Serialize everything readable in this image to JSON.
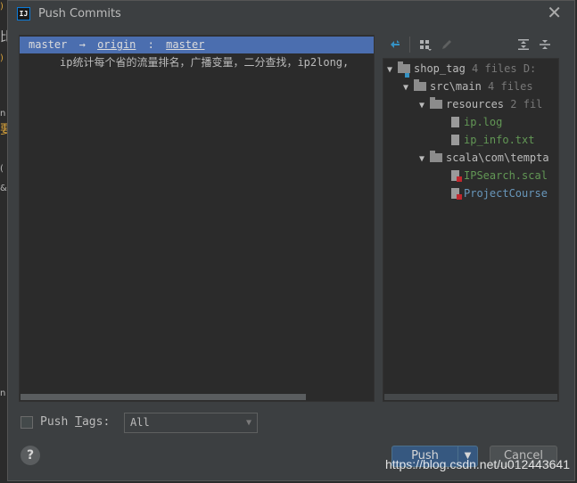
{
  "window": {
    "title": "Push Commits",
    "icon_label": "IJ"
  },
  "commits": {
    "header": {
      "local_branch": "master",
      "arrow": "→",
      "remote": "origin",
      "separator": ":",
      "remote_branch": "master"
    },
    "rows": [
      {
        "message": "ip统计每个省的流量排名，广播变量，二分查找，ip2long,"
      }
    ]
  },
  "toolbar": {
    "icons": [
      "expand-changes-icon",
      "group-by-icon",
      "edit-icon",
      "expand-all-icon",
      "collapse-all-icon"
    ]
  },
  "tree": {
    "nodes": [
      {
        "label": "shop_tag",
        "meta": "4 files D:"
      },
      {
        "label": "src\\main",
        "meta": "4 files"
      },
      {
        "label": "resources",
        "meta": "2 fil"
      },
      {
        "label": "ip.log"
      },
      {
        "label": "ip_info.txt"
      },
      {
        "label": "scala\\com\\tempta"
      },
      {
        "label": "IPSearch.scal"
      },
      {
        "label": "ProjectCourse"
      }
    ]
  },
  "tags": {
    "label_prefix": "Push ",
    "label_mnemonic": "T",
    "label_suffix": "ags:",
    "selected": "All"
  },
  "buttons": {
    "help": "?",
    "push": "Push",
    "cancel": "Cancel"
  },
  "watermark": "https://blog.csdn.net/u012443641",
  "colors": {
    "selection": "#4b6eaf",
    "push_button": "#365880",
    "added_file": "#629755",
    "modified_file": "#6897bb"
  }
}
